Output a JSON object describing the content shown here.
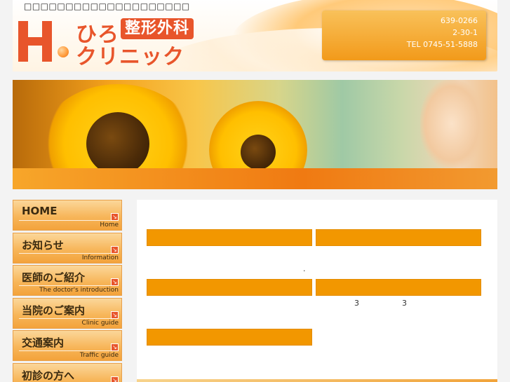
{
  "header": {
    "tagline": "□□□□□□□□□□□□□□□□□□□□",
    "logo_hiro": "ひろ",
    "logo_dept": "整形外科",
    "logo_clinic": "クリニック",
    "address": {
      "postal": "639-0266",
      "street": "2-30-1",
      "tel": "TEL 0745-51-5888"
    }
  },
  "sidebar": {
    "items": [
      {
        "jp": "HOME",
        "en": "Home"
      },
      {
        "jp": "お知らせ",
        "en": "Information"
      },
      {
        "jp": "医師のご紹介",
        "en": "The doctor's introduction"
      },
      {
        "jp": "当院のご案内",
        "en": "Clinic guide"
      },
      {
        "jp": "交通案内",
        "en": "Traffic guide"
      },
      {
        "jp": "初診の方へ",
        "en": ""
      }
    ],
    "arrow_glyph": "↘"
  },
  "content": {
    "bars": [
      "",
      "",
      "",
      "",
      ""
    ],
    "dot": ".",
    "numbers": [
      "3",
      "3"
    ]
  },
  "colors": {
    "accent_orange": "#f29700",
    "logo_red": "#e8552b"
  }
}
